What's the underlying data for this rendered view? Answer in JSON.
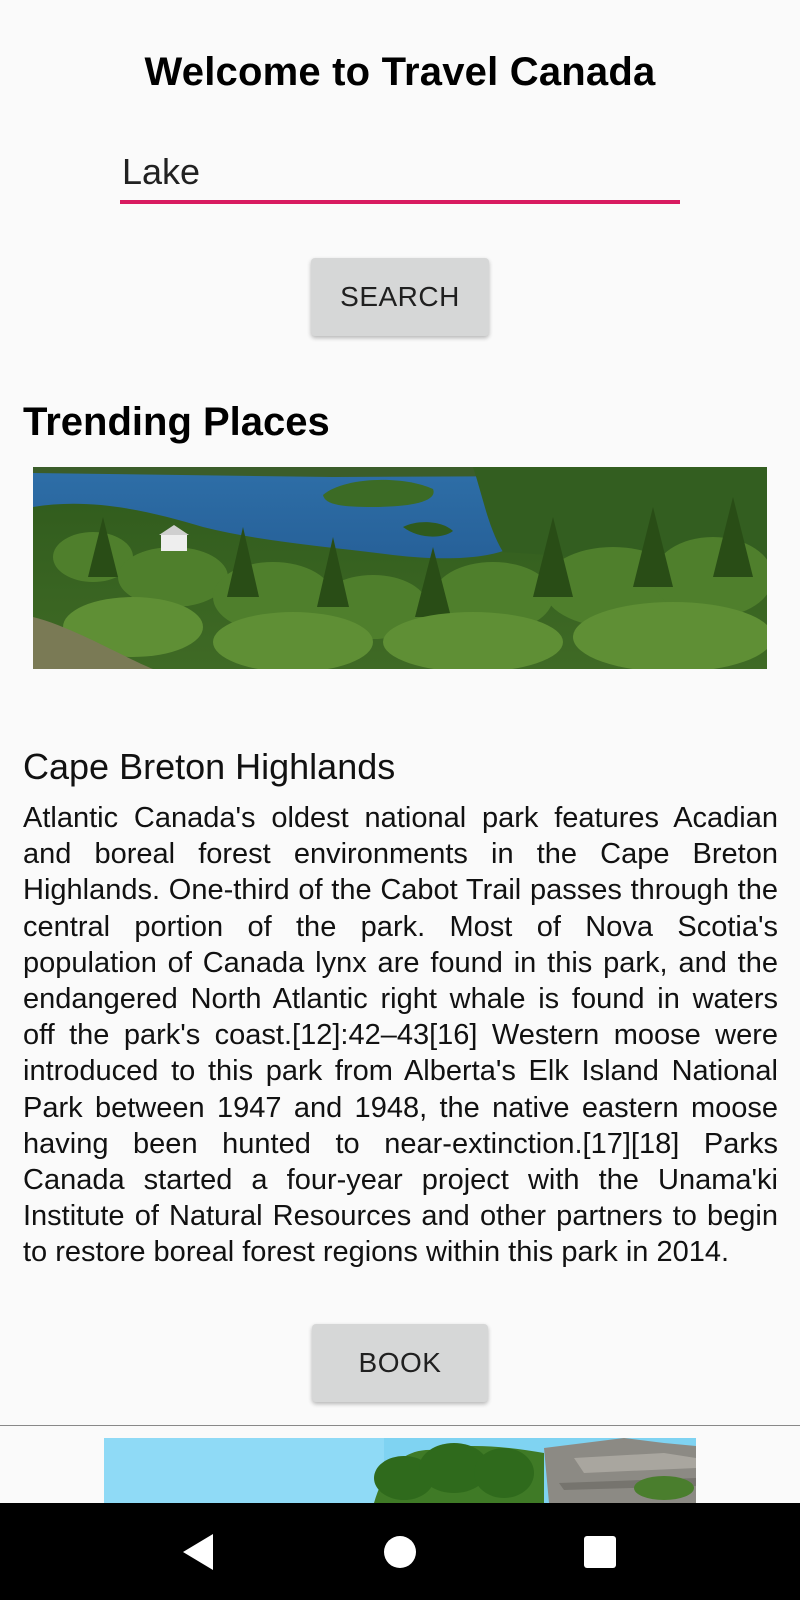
{
  "header": {
    "title": "Welcome to Travel Canada"
  },
  "search": {
    "value": "Lake",
    "button_label": "SEARCH",
    "accent_color": "#d81b60"
  },
  "trending": {
    "heading": "Trending Places",
    "places": [
      {
        "name": "Cape Breton Highlands",
        "description": "Atlantic Canada's oldest national park features Acadian and boreal forest environments in the Cape Breton Highlands. One-third of the Cabot Trail passes through the central portion of the park. Most of Nova Scotia's population of Canada lynx are found in this park, and the endangered North Atlantic right whale is found in waters off the park's coast.[12]:42–43[16] Western moose were introduced to this park from Alberta's Elk Island National Park between 1947 and 1948, the native eastern moose having been hunted to near-extinction.[17][18] Parks Canada started a four-year project with the Unama'ki Institute of Natural Resources and other partners to begin to restore boreal forest regions within this park in 2014.",
        "book_label": "BOOK"
      }
    ]
  },
  "navbar": {
    "back_icon": "triangle-back-icon",
    "home_icon": "circle-home-icon",
    "recents_icon": "square-recents-icon"
  }
}
